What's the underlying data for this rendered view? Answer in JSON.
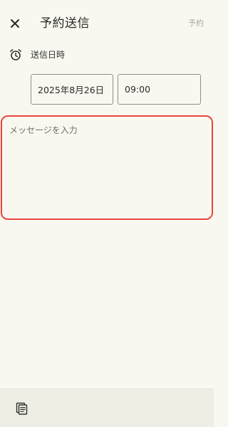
{
  "header": {
    "title": "予約送信",
    "close_icon": "close-icon",
    "schedule_label": "予約"
  },
  "send_datetime": {
    "icon": "alarm-clock-icon",
    "label": "送信日時",
    "date_value": "2025年8月26日",
    "time_value": "09:00"
  },
  "message": {
    "placeholder": "メッセージを入力",
    "value": "",
    "focus_border_color": "#e8463e"
  },
  "bottom_bar": {
    "template_icon": "template-list-icon"
  },
  "colors": {
    "background": "#f9f8f0",
    "bottom_bar": "#eeeee4",
    "disabled_text": "#a7a7a2"
  }
}
